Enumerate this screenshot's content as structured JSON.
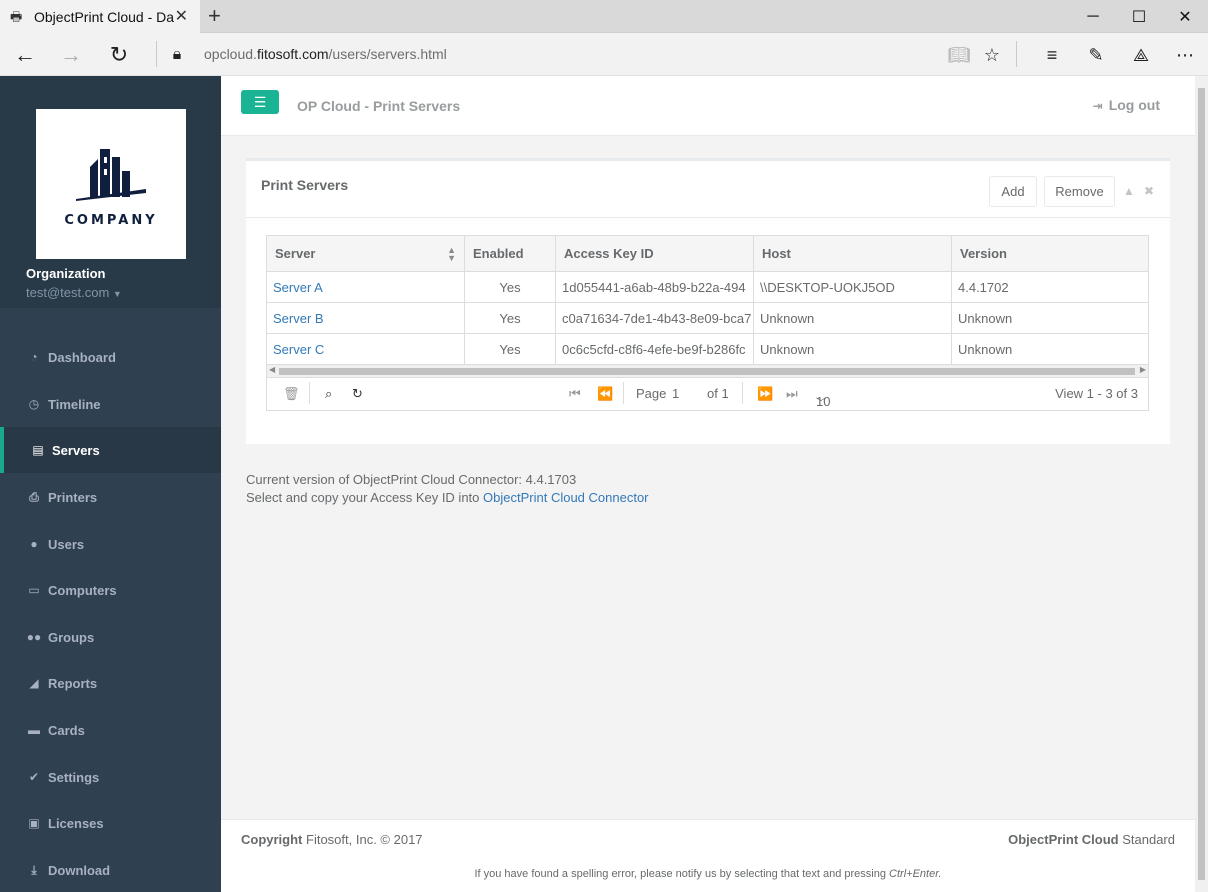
{
  "browser": {
    "tab_title": "ObjectPrint Cloud - Das",
    "url_prefix": "opcloud.",
    "url_domain": "fitosoft.com",
    "url_path": "/users/servers.html"
  },
  "sidebar": {
    "logo_text": "COMPANY",
    "organization_label": "Organization",
    "email": "test@test.com",
    "items": [
      {
        "label": "Dashboard",
        "icon": "dashboard-icon"
      },
      {
        "label": "Timeline",
        "icon": "clock-icon"
      },
      {
        "label": "Servers",
        "icon": "server-icon",
        "active": true
      },
      {
        "label": "Printers",
        "icon": "printer-icon"
      },
      {
        "label": "Users",
        "icon": "user-icon"
      },
      {
        "label": "Computers",
        "icon": "laptop-icon"
      },
      {
        "label": "Groups",
        "icon": "users-icon"
      },
      {
        "label": "Reports",
        "icon": "chart-icon"
      },
      {
        "label": "Cards",
        "icon": "card-icon"
      },
      {
        "label": "Settings",
        "icon": "wrench-icon"
      },
      {
        "label": "Licenses",
        "icon": "license-icon"
      },
      {
        "label": "Download",
        "icon": "download-icon"
      }
    ]
  },
  "header": {
    "title": "OP Cloud - Print Servers",
    "logout": "Log out"
  },
  "panel": {
    "title": "Print Servers",
    "add": "Add",
    "remove": "Remove"
  },
  "table": {
    "columns": [
      "Server",
      "Enabled",
      "Access Key ID",
      "Host",
      "Version"
    ],
    "rows": [
      [
        "Server A",
        "Yes",
        "1d055441-a6ab-48b9-b22a-494",
        "\\\\DESKTOP-UOKJ5OD",
        "4.4.1702"
      ],
      [
        "Server B",
        "Yes",
        "c0a71634-7de1-4b43-8e09-bca7",
        "Unknown",
        "Unknown"
      ],
      [
        "Server C",
        "Yes",
        "0c6c5cfd-c8f6-4efe-be9f-b286fc",
        "Unknown",
        "Unknown"
      ]
    ]
  },
  "pager": {
    "page_label": "Page",
    "page_value": "1",
    "of_label": "of 1",
    "page_size": "10",
    "view_info": "View 1 - 3 of 3"
  },
  "info": {
    "version_line": "Current version of ObjectPrint Cloud Connector: 4.4.1703",
    "copy_prefix": "Select and copy your Access Key ID into",
    "connector_link": "ObjectPrint Cloud Connector"
  },
  "footer": {
    "copyright_bold": "Copyright",
    "copyright_rest": "Fitosoft, Inc. © 2017",
    "product_bold": "ObjectPrint Cloud",
    "product_edition": "Standard",
    "note_prefix": "If you have found a spelling error, please notify us by selecting that text and pressing",
    "note_keys": "Ctrl+Enter."
  },
  "colors": {
    "sidebar": "#2f4050",
    "accent": "#1ab394",
    "link": "#337ab7"
  }
}
